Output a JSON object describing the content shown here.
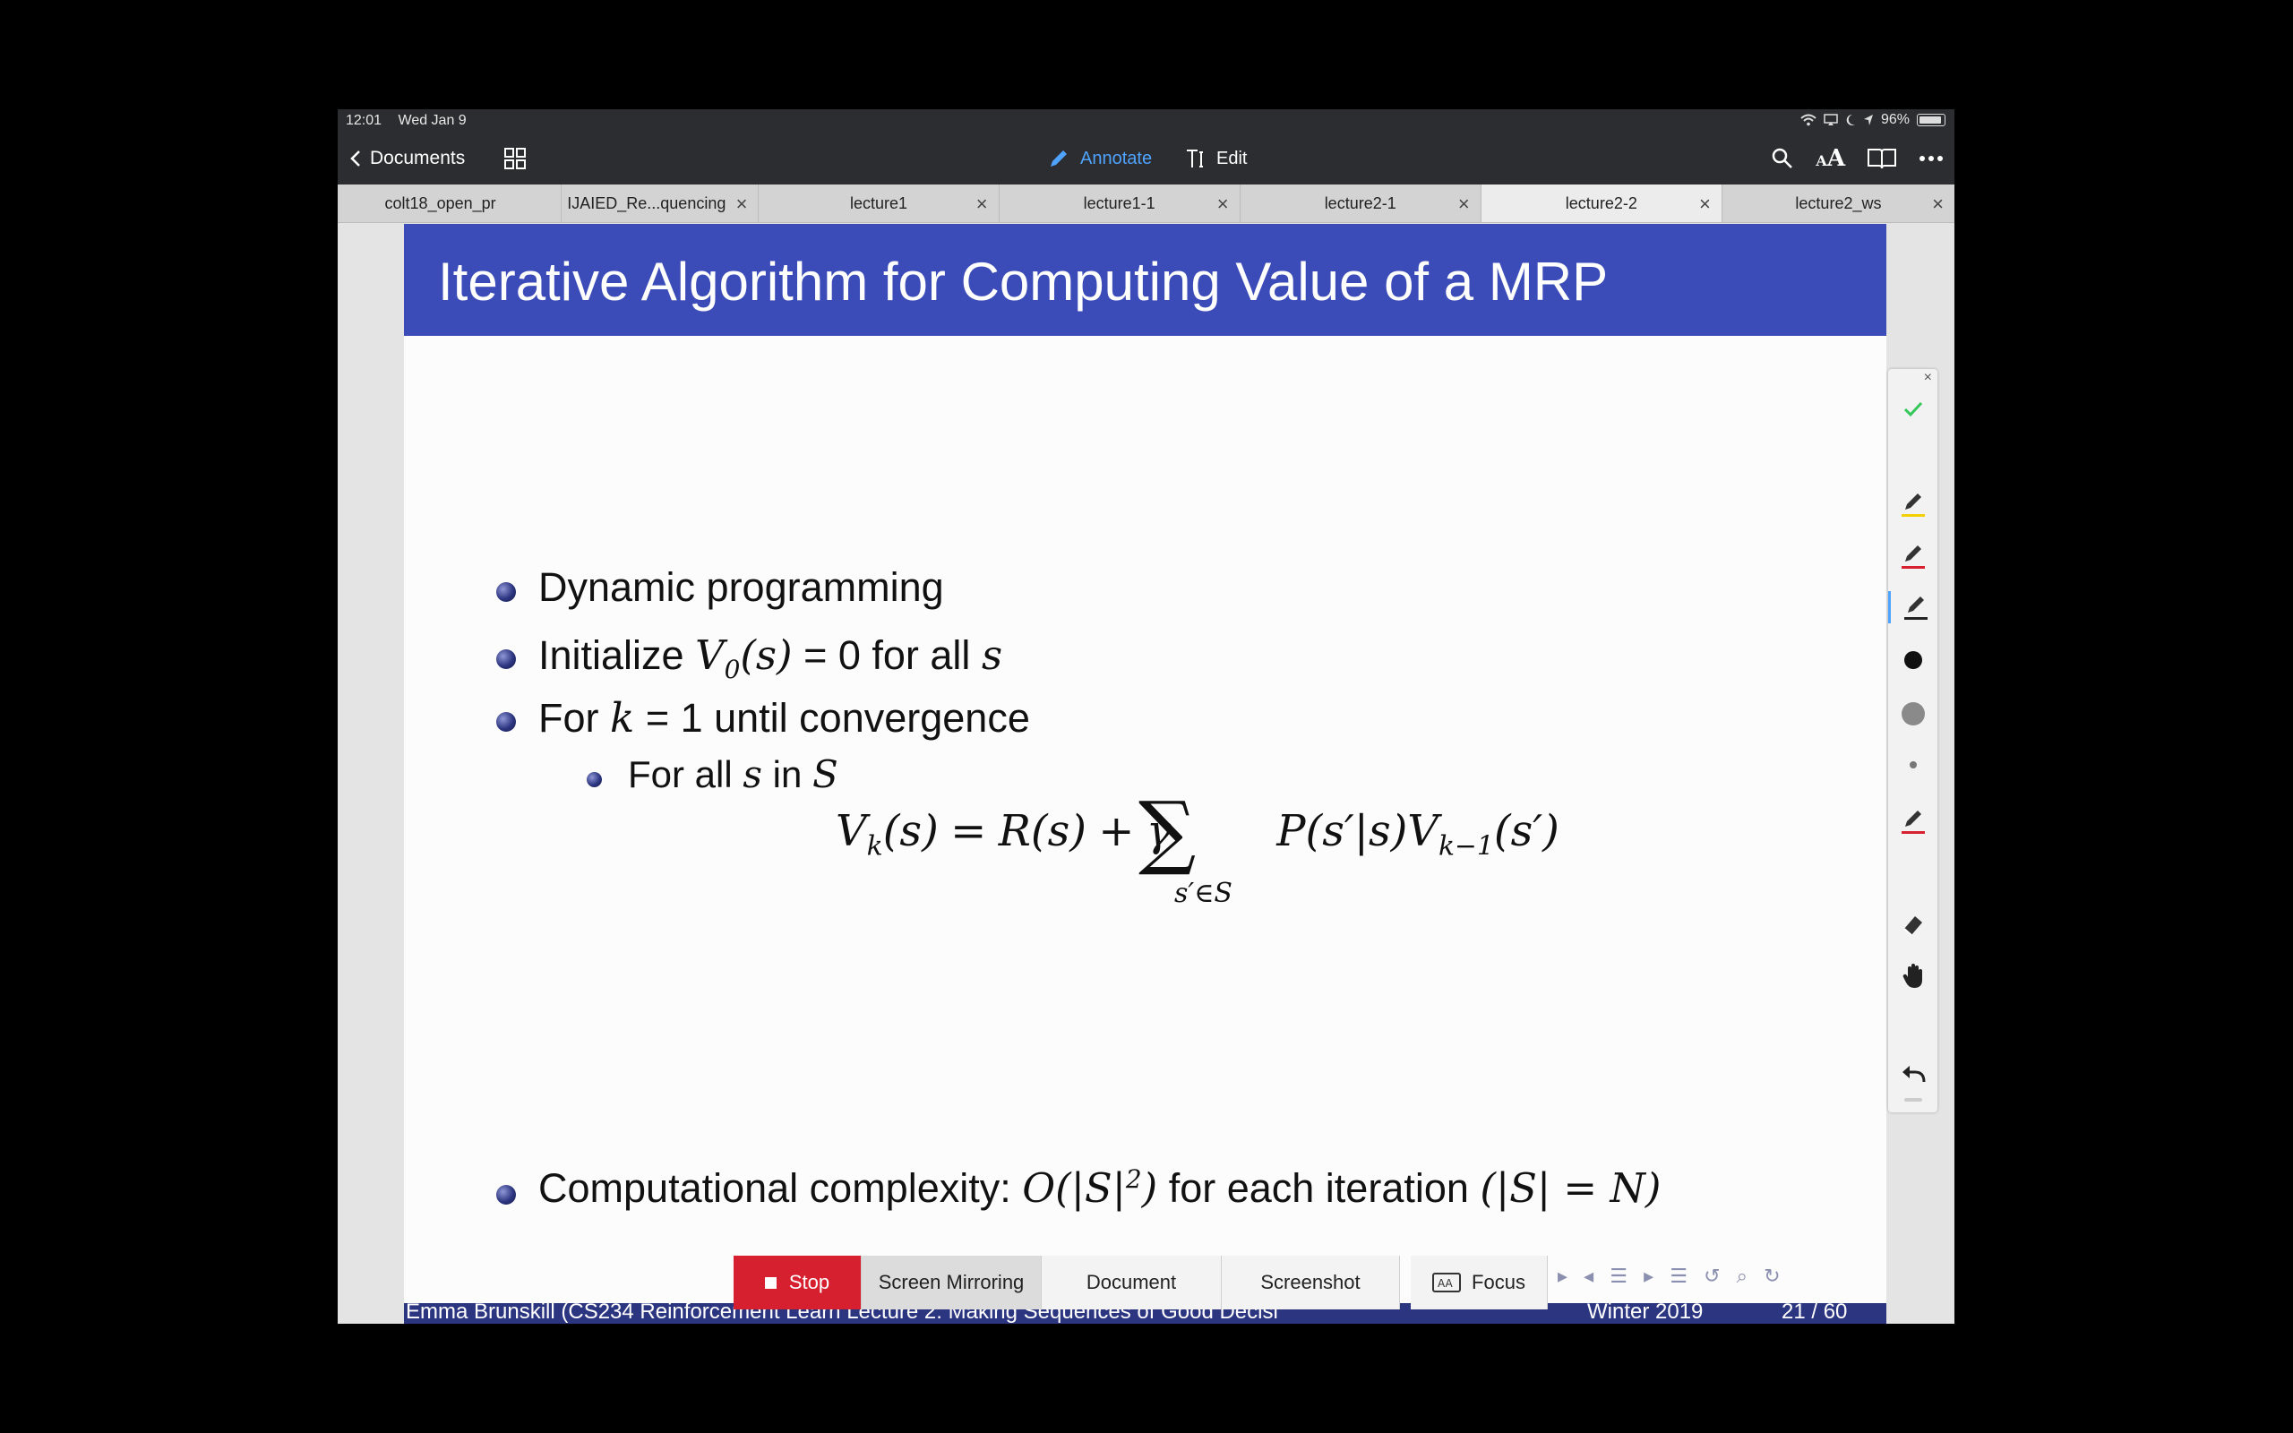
{
  "status": {
    "time": "12:01",
    "date": "Wed Jan 9",
    "battery": "96%"
  },
  "toolbar": {
    "back_label": "Documents",
    "annotate_label": "Annotate",
    "edit_label": "Edit",
    "font_glyph": "AA"
  },
  "tabs": [
    {
      "label": "colt18_open_pr",
      "closable": false
    },
    {
      "label": "IJAIED_Re...quencing",
      "closable": true
    },
    {
      "label": "lecture1",
      "closable": true
    },
    {
      "label": "lecture1-1",
      "closable": true
    },
    {
      "label": "lecture2-1",
      "closable": true
    },
    {
      "label": "lecture2-2",
      "closable": true,
      "active": true
    },
    {
      "label": "lecture2_ws",
      "closable": true
    }
  ],
  "slide": {
    "title": "Iterative Algorithm for Computing Value of a MRP",
    "bullets": {
      "b1": "Dynamic programming",
      "b2_pre": "Initialize",
      "b2_mid": "= 0 for all",
      "b3_pre": "For",
      "b3_mid": "= 1 until convergence",
      "b4_pre": "For all",
      "b4_mid": "in",
      "b5_pre": "Computational complexity:",
      "b5_mid": "for each iteration"
    },
    "footer": {
      "left": "Emma Brunskill (CS234 Reinforcement Learn Lecture 2: Making Sequences of Good Decisi",
      "term": "Winter 2019",
      "page": "21 / 60"
    }
  },
  "recording_bar": {
    "stop_label": "Stop",
    "mirror_label": "Screen Mirroring",
    "document_label": "Document",
    "screenshot_label": "Screenshot",
    "focus_label": "Focus"
  },
  "colors": {
    "slide_header": "#3b4cb8",
    "footer": "#2c3580",
    "annotate_accent": "#4fa3ff",
    "stop": "#d6202f"
  }
}
